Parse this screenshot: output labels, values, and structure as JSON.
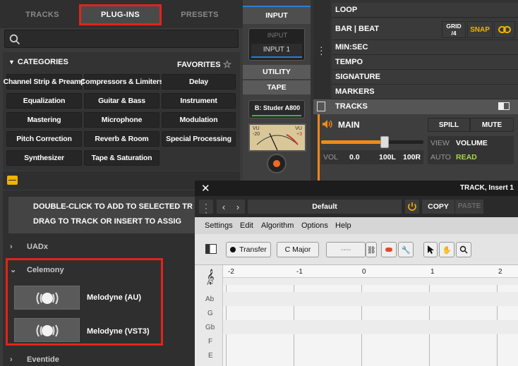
{
  "browser": {
    "tabs": [
      "TRACKS",
      "PLUG-INS",
      "PRESETS"
    ],
    "categories_label": "CATEGORIES",
    "favorites_label": "FAVORITES",
    "categories": [
      "Channel Strip & Preamp",
      "Compressors & Limiters",
      "Delay",
      "Equalization",
      "Guitar & Bass",
      "Instrument",
      "Mastering",
      "Microphone",
      "Modulation",
      "Pitch Correction",
      "Reverb & Room",
      "Special Processing",
      "Synthesizer",
      "Tape & Saturation"
    ],
    "notice_line1": "DOUBLE-CLICK TO ADD TO SELECTED TR",
    "notice_line2": "DRAG TO TRACK OR INSERT TO ASSIG",
    "tree": {
      "uadx": "UADx",
      "celemony": "Celemony",
      "plugin1": "Melodyne (AU)",
      "plugin2": "Melodyne (VST3)",
      "eventide": "Eventide"
    }
  },
  "strip": {
    "input_header": "INPUT",
    "input_top": "INPUT",
    "input_value": "INPUT 1",
    "utility": "UTILITY",
    "tape": "TAPE",
    "tape_machine": "B: Studer A800",
    "vu_left": "VU",
    "vu_right": "VU",
    "vu_minus": "-20",
    "vu_plus": "+3"
  },
  "ruler": {
    "loop": "LOOP",
    "bar_beat": "BAR | BEAT",
    "grid_label": "GRID",
    "grid_value": "/4",
    "snap": "SNAP",
    "minsec": "MIN:SEC",
    "tempo": "TEMPO",
    "signature": "SIGNATURE",
    "markers": "MARKERS",
    "tracks": "TRACKS"
  },
  "track": {
    "name": "MAIN",
    "spill": "SPILL",
    "mute": "MUTE",
    "view_label": "VIEW",
    "view_value": "VOLUME",
    "auto_label": "AUTO",
    "auto_value": "READ",
    "vol_label": "VOL",
    "vol_value": "0.0",
    "pan_left": "100L",
    "pan_right": "100R",
    "fader_level": 0.62
  },
  "plugin_window": {
    "title": "TRACK, Insert 1",
    "preset": "Default",
    "copy": "COPY",
    "paste": "PASTE",
    "menus": [
      "Settings",
      "Edit",
      "Algorithm",
      "Options",
      "Help"
    ],
    "transfer": "Transfer",
    "key": "C Major",
    "tempo_field": "----",
    "ruler_marks": [
      "-2",
      "-1",
      "0",
      "1",
      "2"
    ],
    "notes": [
      "A",
      "Ab",
      "G",
      "Gb",
      "F",
      "E"
    ]
  },
  "colors": {
    "accent_red": "#e2231a",
    "snap_yellow": "#f0b400",
    "read_green": "#a8d84a",
    "track_orange": "#f08a1c",
    "input_blue": "#2a7fd4"
  }
}
